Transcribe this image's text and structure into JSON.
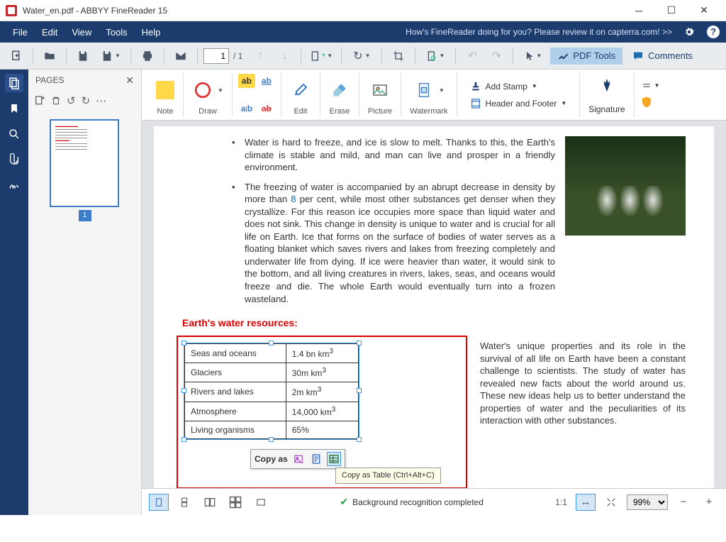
{
  "titlebar": {
    "title": "Water_en.pdf - ABBYY FineReader 15"
  },
  "menu": {
    "file": "File",
    "edit": "Edit",
    "view": "View",
    "tools": "Tools",
    "help": "Help",
    "review": "How's FineReader doing for you? Please review it on capterra.com! >>"
  },
  "toolbar": {
    "page_current": "1",
    "page_total": "/ 1",
    "pdf_tools": "PDF Tools",
    "comments": "Comments"
  },
  "pages_panel": {
    "title": "PAGES",
    "thumb_num": "1"
  },
  "ribbon": {
    "note": "Note",
    "draw": "Draw",
    "edit": "Edit",
    "erase": "Erase",
    "picture": "Picture",
    "watermark": "Watermark",
    "add_stamp": "Add Stamp",
    "header_footer": "Header and Footer",
    "signature": "Signature"
  },
  "doc": {
    "bullet1": "Water is hard to freeze, and ice is slow to melt. Thanks to this, the Earth's climate is stable and mild, and man can live and prosper in a friendly environment.",
    "bullet2a": "The freezing of water is accompanied by an abrupt decrease in density by more than ",
    "bullet2_num": "8",
    "bullet2b": " per cent, while most other substances get denser when they crystallize. For this reason ice occupies more space than liquid water and does not sink. This change in density is unique to water and is crucial for all life on Earth. Ice that forms on the surface of bodies of water serves as a floating blanket which saves rivers and lakes from freezing completely and underwater life from dying. If ice were heavier than water, it would sink to the bottom, and all living creatures in rivers, lakes, seas, and oceans would freeze and die. The whole Earth would eventually turn into a frozen wasteland.",
    "heading": "Earth's water resources:",
    "table": {
      "rows": [
        [
          "Seas and oceans",
          "1.4 bn km",
          "3"
        ],
        [
          "Glaciers",
          "30m km",
          "3"
        ],
        [
          "Rivers and lakes",
          "2m km",
          "3"
        ],
        [
          "Atmosphere",
          "14,000 km",
          "3"
        ],
        [
          "Living organisms",
          "65%",
          ""
        ]
      ]
    },
    "side_text": "Water's unique properties and its role in the survival of all life on Earth have been a constant challenge to scientists. The study of water has revealed new facts about the world around us. These new ideas help us to better understand the properties of water and the peculiarities of its interaction with other substances.",
    "copy_as": "Copy as",
    "tooltip": "Copy as Table (Ctrl+Alt+C)"
  },
  "status": {
    "msg": "Background recognition completed",
    "ratio": "1:1",
    "zoom": "99%"
  }
}
